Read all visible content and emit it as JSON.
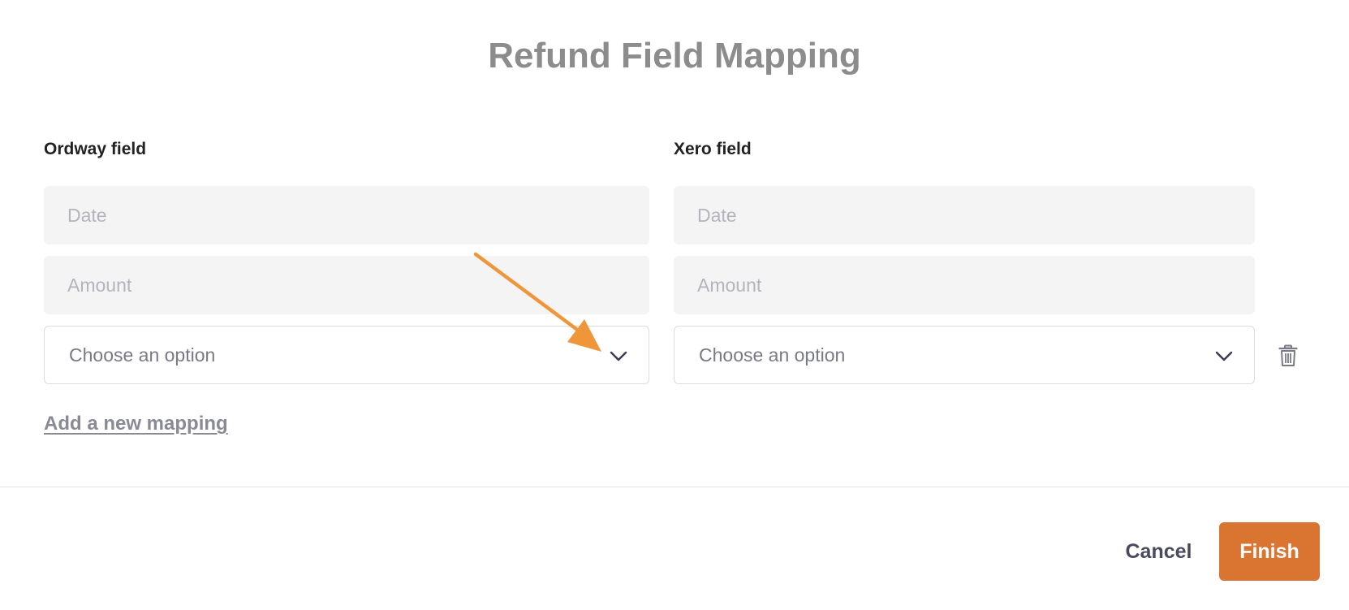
{
  "dialog": {
    "title": "Refund Field Mapping"
  },
  "columns": {
    "left_label": "Ordway field",
    "right_label": "Xero field"
  },
  "rows": [
    {
      "left": "Date",
      "right": "Date"
    },
    {
      "left": "Amount",
      "right": "Amount"
    }
  ],
  "new_row": {
    "left_placeholder": "Choose an option",
    "right_placeholder": "Choose an option",
    "delete_icon": "trash-icon"
  },
  "add_mapping_label": "Add a new mapping",
  "footer": {
    "cancel_label": "Cancel",
    "finish_label": "Finish"
  },
  "colors": {
    "accent": "#d97431",
    "annotation_arrow": "#f0963a"
  }
}
